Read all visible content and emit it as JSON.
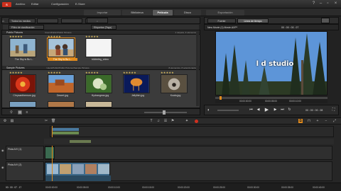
{
  "app": {
    "logo": "S",
    "menus": [
      "Archivo",
      "Editar",
      "Configuración",
      "E-Store"
    ]
  },
  "tabs": {
    "import": "Importar",
    "library": "Biblioteca",
    "movie": "Película",
    "disc": "Disco",
    "export": "Exportación"
  },
  "library": {
    "location_button": "Todos los medios",
    "filter_button": "Filtro de clasificación",
    "tags_button": "Etiquetas (Tags)",
    "sections": [
      {
        "title": "Public Pictures",
        "path": "Users\\Public\\Public Pictures",
        "info": "1 carpeta, 3 elementos"
      },
      {
        "title": "Sample Pictures",
        "path": "Users\\Public\\Public Pictures\\Sample Pictures",
        "info": "8 elementos, 8 seleccionados"
      }
    ],
    "row1": [
      {
        "name": "The Sky is Bu L..",
        "stars": "★★★★★"
      },
      {
        "name": "The Sky is Bu L..",
        "stars": "★★★★★"
      },
      {
        "name": "blAbblbg_video",
        "stars": "★★★★★"
      }
    ],
    "row2": [
      {
        "name": "Chrysanthemum.jpg",
        "stars": "★★★★★"
      },
      {
        "name": "Desert.jpg",
        "stars": "★★★★★"
      },
      {
        "name": "Hydrangeas.jpg",
        "stars": "★★★★★"
      },
      {
        "name": "Jellyfish.jpg",
        "stars": "★★★★★"
      },
      {
        "name": "Koala.jpg",
        "stars": "★★★★★"
      }
    ]
  },
  "player": {
    "tab_source": "Fuente",
    "tab_timeline": "Línea de tiempo",
    "movie_name": "New Movie (1) Movie.AXP*",
    "timecode": "00 : 00 : 00 . 07",
    "caption": "l   d studio",
    "scale_start": "00:00:00:00",
    "scale_mid": "00:00:05:00",
    "scale_end": "00:00:10:00",
    "bottom_time": "00 : 00 : 00 . 08"
  },
  "timeline": {
    "track1_name": "Pista A/V (1)",
    "track2_name": "Pista A/V (2)",
    "ruler": [
      "00:00:00:00",
      "00:00:05:00",
      "00:00:10:00",
      "00:00:15:00",
      "00:00:20:00",
      "00:00:25:00",
      "00:00:30:00",
      "00:00:35:00",
      "00:00:40:00"
    ],
    "status_time": "00 : 00 : 07 . 17"
  },
  "colors": {
    "accent": "#e08a1c",
    "brand": "#cc2f1c"
  }
}
